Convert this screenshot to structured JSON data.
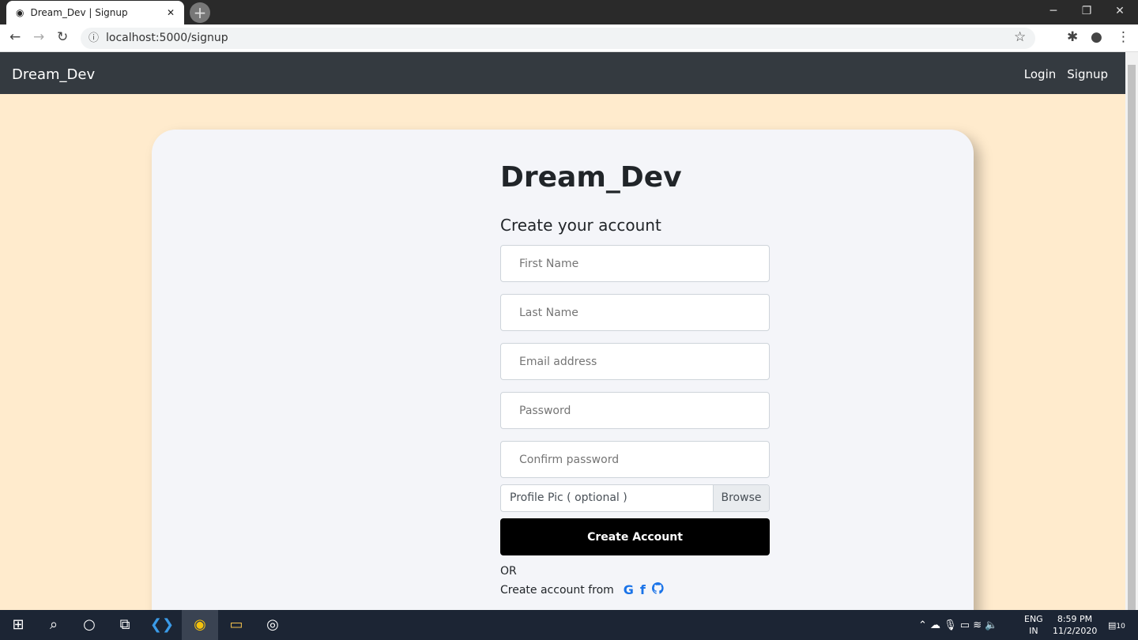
{
  "browser": {
    "tab_title": "Dream_Dev | Signup",
    "url": "localhost:5000/signup"
  },
  "navbar": {
    "brand": "Dream_Dev",
    "links": [
      "Login",
      "Signup"
    ]
  },
  "form": {
    "title": "Dream_Dev",
    "subtitle": "Create your account",
    "fields": [
      {
        "placeholder": "First Name"
      },
      {
        "placeholder": "Last Name"
      },
      {
        "placeholder": "Email address"
      },
      {
        "placeholder": "Password"
      },
      {
        "placeholder": "Confirm password"
      }
    ],
    "file_label": "Profile Pic ( optional )",
    "browse": "Browse",
    "submit": "Create Account",
    "or": "OR",
    "social_text": "Create account from",
    "social": [
      "google-icon",
      "facebook-icon",
      "github-icon"
    ]
  },
  "taskbar": {
    "lang1": "ENG",
    "lang2": "IN",
    "time": "8:59 PM",
    "date": "11/2/2020",
    "notifications": "10"
  },
  "colors": {
    "navbar": "#343a40",
    "background": "#ffebcd",
    "button": "#000000",
    "social": "#1a73e8"
  }
}
